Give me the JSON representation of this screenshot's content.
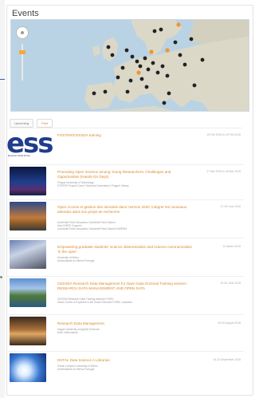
{
  "heading": "Events",
  "tabs": [
    "Upcoming",
    "Past"
  ],
  "events": [
    {
      "title": "FOSTER/CESSDA training",
      "meta": [
        "",
        ""
      ],
      "date": "13 Feb 2015 to 19 Feb 2015",
      "thumb": "ess-logo",
      "logo_text": "ess",
      "logo_sub": "European Social Survey"
    },
    {
      "title": "Promoting Open Science among Young Researchers: Challenges and Opportunities (Hands-On Days)",
      "meta": [
        "Prague University of Technology",
        "FOSTER Project/ Czech Technical University in Prague/ Library"
      ],
      "date": "17 Mar 2015 to 18 Mar 2015",
      "thumb": "night-building"
    },
    {
      "title": "Open Access et gestion des données dans Horizon 2020: intégrer les nouveaux attendus dans son projet de recherche",
      "meta": [
        "Université Paris Descartes/ Université Paris Diderot",
        "Inist-CNRS/ Couperin",
        "Université Paris Descartes/ Université Paris Diderot/ INSERM"
      ],
      "date": "27-28 June 2015",
      "thumb": "campus-sunset"
    },
    {
      "title": "Empowering graduate students: science dissemination and science communication 'in the open'",
      "meta": [
        "University of Minho",
        "Universidade do Minho/ Portugal"
      ],
      "date": "14 March 2015",
      "thumb": "modern-building"
    },
    {
      "title": "CESSDA Research Data Management for Open Data Doctoral Training session: RESEARCH DATA MANAGEMENT AND OPEN DATA",
      "meta": [
        "CESSDA Research Data Training Network/ FORS",
        "Swiss Centre of Expertise in the Social Sciences FORS/ Lausanne"
      ],
      "date": "19-20 June 2015",
      "thumb": "lake-house"
    },
    {
      "title": "Research Data Management",
      "meta": [
        "Hague University of Applied Sciences",
        "Delft, Netherlands"
      ],
      "date": "29-30 August 2015",
      "thumb": "old-castle"
    },
    {
      "title": "DSTAL Data Science A Librarian",
      "meta": [
        "Virtual Campus/ University of Minho",
        "Universidade do Minho/ Portugal"
      ],
      "date": "10-12 September 2015",
      "thumb": "light-abstract"
    }
  ]
}
